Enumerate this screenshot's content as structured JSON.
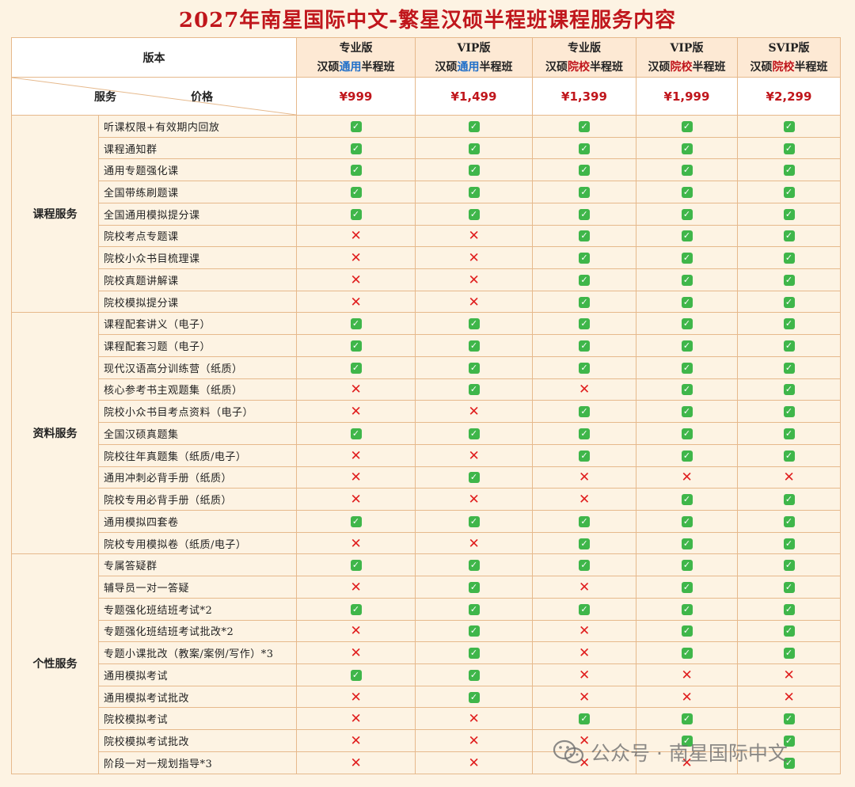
{
  "title": "2027年南星国际中文-繁星汉硕半程班课程服务内容",
  "header": {
    "version_label": "版本",
    "service_label": "服务",
    "price_label": "价格",
    "plans": [
      {
        "tier": "专业版",
        "prefix": "汉硕",
        "track": "通用",
        "track_color": "#1f6fc9",
        "suffix": "半程班",
        "price": "¥999"
      },
      {
        "tier": "VIP版",
        "prefix": "汉硕",
        "track": "通用",
        "track_color": "#1f6fc9",
        "suffix": "半程班",
        "price": "¥1,499"
      },
      {
        "tier": "专业版",
        "prefix": "汉硕",
        "track": "院校",
        "track_color": "#c0161c",
        "suffix": "半程班",
        "price": "¥1,399"
      },
      {
        "tier": "VIP版",
        "prefix": "汉硕",
        "track": "院校",
        "track_color": "#c0161c",
        "suffix": "半程班",
        "price": "¥1,999"
      },
      {
        "tier": "SVIP版",
        "prefix": "汉硕",
        "track": "院校",
        "track_color": "#c0161c",
        "suffix": "半程班",
        "price": "¥2,299"
      }
    ]
  },
  "marks": {
    "yes": "✓",
    "no": "✕",
    "yes_color": "#3fb64a",
    "no_color": "#e01e1e"
  },
  "sections": [
    {
      "name": "课程服务",
      "items": [
        {
          "label": "听课权限+有效期内回放",
          "vals": [
            1,
            1,
            1,
            1,
            1
          ]
        },
        {
          "label": "课程通知群",
          "vals": [
            1,
            1,
            1,
            1,
            1
          ]
        },
        {
          "label": "通用专题强化课",
          "vals": [
            1,
            1,
            1,
            1,
            1
          ]
        },
        {
          "label": "全国带练刷题课",
          "vals": [
            1,
            1,
            1,
            1,
            1
          ]
        },
        {
          "label": "全国通用模拟提分课",
          "vals": [
            1,
            1,
            1,
            1,
            1
          ]
        },
        {
          "label": "院校考点专题课",
          "vals": [
            0,
            0,
            1,
            1,
            1
          ]
        },
        {
          "label": "院校小众书目梳理课",
          "vals": [
            0,
            0,
            1,
            1,
            1
          ]
        },
        {
          "label": "院校真题讲解课",
          "vals": [
            0,
            0,
            1,
            1,
            1
          ]
        },
        {
          "label": "院校模拟提分课",
          "vals": [
            0,
            0,
            1,
            1,
            1
          ]
        }
      ]
    },
    {
      "name": "资料服务",
      "items": [
        {
          "label": "课程配套讲义（电子）",
          "vals": [
            1,
            1,
            1,
            1,
            1
          ]
        },
        {
          "label": "课程配套习题（电子）",
          "vals": [
            1,
            1,
            1,
            1,
            1
          ]
        },
        {
          "label": "现代汉语高分训练营（纸质）",
          "vals": [
            1,
            1,
            1,
            1,
            1
          ]
        },
        {
          "label": "核心参考书主观题集（纸质）",
          "vals": [
            0,
            1,
            0,
            1,
            1
          ]
        },
        {
          "label": "院校小众书目考点资料（电子）",
          "vals": [
            0,
            0,
            1,
            1,
            1
          ]
        },
        {
          "label": "全国汉硕真题集",
          "vals": [
            1,
            1,
            1,
            1,
            1
          ]
        },
        {
          "label": "院校往年真题集（纸质/电子）",
          "vals": [
            0,
            0,
            1,
            1,
            1
          ]
        },
        {
          "label": "通用冲刺必背手册（纸质）",
          "vals": [
            0,
            1,
            0,
            0,
            0
          ]
        },
        {
          "label": "院校专用必背手册（纸质）",
          "vals": [
            0,
            0,
            0,
            1,
            1
          ]
        },
        {
          "label": "通用模拟四套卷",
          "vals": [
            1,
            1,
            1,
            1,
            1
          ]
        },
        {
          "label": "院校专用模拟卷（纸质/电子）",
          "vals": [
            0,
            0,
            1,
            1,
            1
          ]
        }
      ]
    },
    {
      "name": "个性服务",
      "items": [
        {
          "label": "专属答疑群",
          "vals": [
            1,
            1,
            1,
            1,
            1
          ]
        },
        {
          "label": "辅导员一对一答疑",
          "vals": [
            0,
            1,
            0,
            1,
            1
          ]
        },
        {
          "label": "专题强化班结班考试*2",
          "vals": [
            1,
            1,
            1,
            1,
            1
          ]
        },
        {
          "label": "专题强化班结班考试批改*2",
          "vals": [
            0,
            1,
            0,
            1,
            1
          ]
        },
        {
          "label": "专题小课批改（教案/案例/写作）*3",
          "vals": [
            0,
            1,
            0,
            1,
            1
          ]
        },
        {
          "label": "通用模拟考试",
          "vals": [
            1,
            1,
            0,
            0,
            0
          ]
        },
        {
          "label": "通用模拟考试批改",
          "vals": [
            0,
            1,
            0,
            0,
            0
          ]
        },
        {
          "label": "院校模拟考试",
          "vals": [
            0,
            0,
            1,
            1,
            1
          ]
        },
        {
          "label": "院校模拟考试批改",
          "vals": [
            0,
            0,
            0,
            1,
            1
          ]
        },
        {
          "label": "阶段一对一规划指导*3",
          "vals": [
            0,
            0,
            0,
            0,
            1
          ]
        }
      ]
    }
  ],
  "watermark": {
    "text": "公众号 · 南星国际中文",
    "icon": "wechat-icon"
  }
}
